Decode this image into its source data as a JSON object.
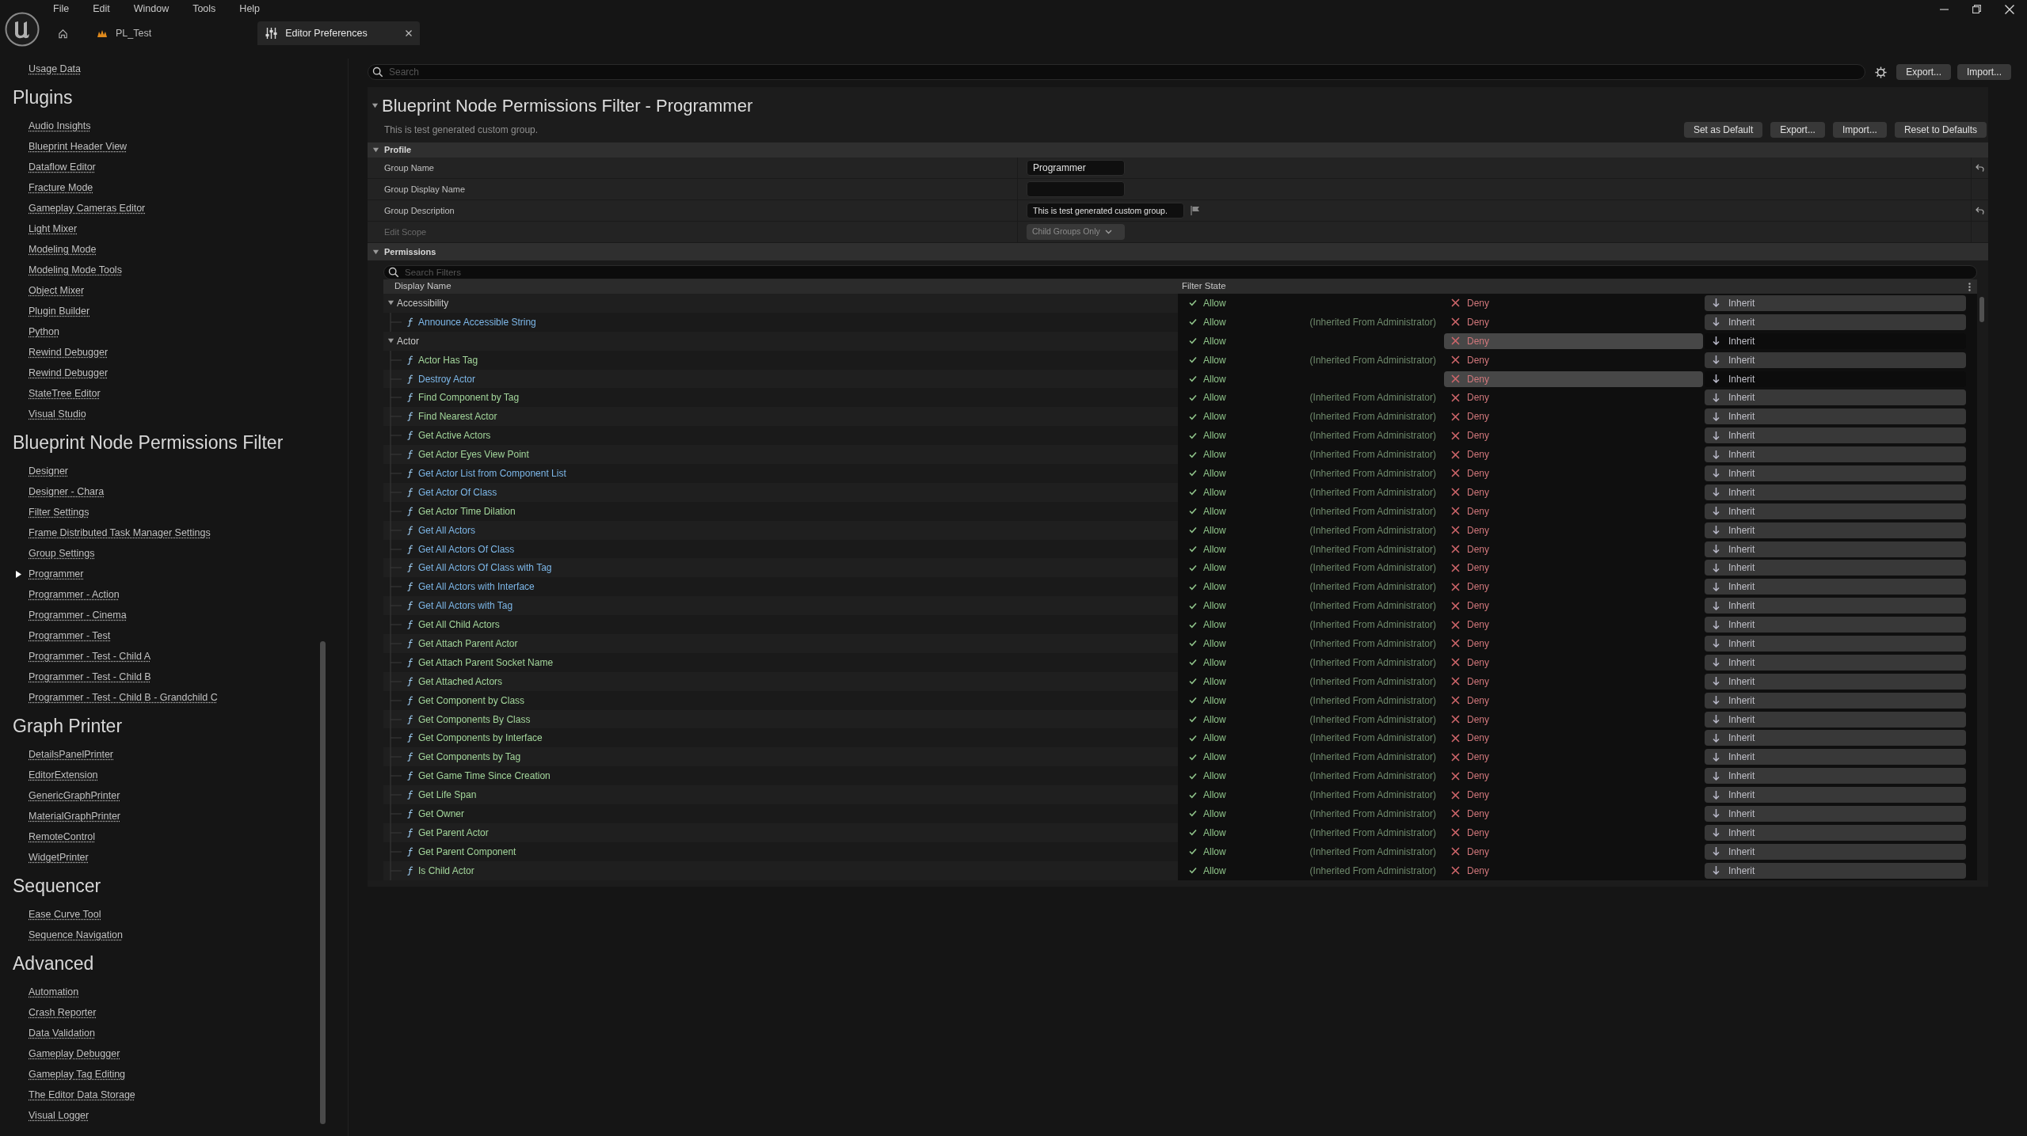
{
  "menu": [
    "File",
    "Edit",
    "Window",
    "Tools",
    "Help"
  ],
  "tabs": [
    {
      "label": "PL_Test",
      "selected": false
    },
    {
      "label": "Editor Preferences",
      "selected": true
    }
  ],
  "sidebar": {
    "top_items": [
      {
        "label": "Usage Data",
        "selected": false
      }
    ],
    "sections": [
      {
        "title": "Plugins",
        "items": [
          {
            "label": "Audio Insights",
            "selected": false
          },
          {
            "label": "Blueprint Header View",
            "selected": false
          },
          {
            "label": "Dataflow Editor",
            "selected": false
          },
          {
            "label": "Fracture Mode",
            "selected": false
          },
          {
            "label": "Gameplay Cameras Editor",
            "selected": false
          },
          {
            "label": "Light Mixer",
            "selected": false
          },
          {
            "label": "Modeling Mode",
            "selected": false
          },
          {
            "label": "Modeling Mode Tools",
            "selected": false
          },
          {
            "label": "Object Mixer",
            "selected": false
          },
          {
            "label": "Plugin Builder",
            "selected": false
          },
          {
            "label": "Python",
            "selected": false
          },
          {
            "label": "Rewind Debugger",
            "selected": false
          },
          {
            "label": "Rewind Debugger",
            "selected": false
          },
          {
            "label": "StateTree Editor",
            "selected": false
          },
          {
            "label": "Visual Studio",
            "selected": false
          }
        ]
      },
      {
        "title": "Blueprint Node Permissions Filter",
        "items": [
          {
            "label": "Designer",
            "selected": false
          },
          {
            "label": "Designer - Chara",
            "selected": false
          },
          {
            "label": "Filter Settings",
            "selected": false
          },
          {
            "label": "Frame Distributed Task Manager Settings",
            "selected": false
          },
          {
            "label": "Group Settings",
            "selected": false
          },
          {
            "label": "Programmer",
            "selected": true
          },
          {
            "label": "Programmer - Action",
            "selected": false
          },
          {
            "label": "Programmer - Cinema",
            "selected": false
          },
          {
            "label": "Programmer - Test",
            "selected": false
          },
          {
            "label": "Programmer - Test - Child A",
            "selected": false
          },
          {
            "label": "Programmer - Test - Child B",
            "selected": false
          },
          {
            "label": "Programmer - Test - Child B - Grandchild C",
            "selected": false
          }
        ]
      },
      {
        "title": "Graph Printer",
        "items": [
          {
            "label": "DetailsPanelPrinter",
            "selected": false
          },
          {
            "label": "EditorExtension",
            "selected": false
          },
          {
            "label": "GenericGraphPrinter",
            "selected": false
          },
          {
            "label": "MaterialGraphPrinter",
            "selected": false
          },
          {
            "label": "RemoteControl",
            "selected": false
          },
          {
            "label": "WidgetPrinter",
            "selected": false
          }
        ]
      },
      {
        "title": "Sequencer",
        "items": [
          {
            "label": "Ease Curve Tool",
            "selected": false
          },
          {
            "label": "Sequence Navigation",
            "selected": false
          }
        ]
      },
      {
        "title": "Advanced",
        "items": [
          {
            "label": "Automation",
            "selected": false
          },
          {
            "label": "Crash Reporter",
            "selected": false
          },
          {
            "label": "Data Validation",
            "selected": false
          },
          {
            "label": "Gameplay Debugger",
            "selected": false
          },
          {
            "label": "Gameplay Tag Editing",
            "selected": false
          },
          {
            "label": "The Editor Data Storage",
            "selected": false
          },
          {
            "label": "Visual Logger",
            "selected": false
          }
        ]
      }
    ]
  },
  "search": {
    "placeholder": "Search"
  },
  "toolbar_buttons": [
    "Export...",
    "Import..."
  ],
  "header": {
    "title": "Blueprint Node Permissions Filter - Programmer",
    "expanded": true,
    "description": "This is test generated custom group.",
    "buttons": [
      "Set as Default",
      "Export...",
      "Import...",
      "Reset to Defaults"
    ]
  },
  "profile": {
    "title": "Profile",
    "expanded": true,
    "fields": [
      {
        "label": "Group Name",
        "kind": "text",
        "value": "Programmer",
        "disabled": false,
        "reset": true
      },
      {
        "label": "Group Display Name",
        "kind": "text",
        "disabled": false,
        "reset": false
      },
      {
        "label": "Group Description",
        "kind": "flagged_text",
        "value": "This is test generated custom group.",
        "disabled": false,
        "reset": true
      },
      {
        "label": "Edit Scope",
        "kind": "dropdown",
        "value": "Child Groups Only",
        "disabled": true,
        "reset": false
      }
    ]
  },
  "permissions": {
    "title": "Permissions",
    "expanded": true,
    "search_placeholder": "Search Filters",
    "columns": [
      "Display Name",
      "Filter State"
    ],
    "groups": [
      {
        "name": "Accessibility",
        "expanded": true,
        "options": [
          {
            "label": "Allow",
            "selected": false
          },
          {
            "label": "Deny",
            "selected": false
          },
          {
            "label": "Inherit",
            "selected": true
          }
        ],
        "children": [
          {
            "name": "Announce Accessible String",
            "color": "#7db7e8",
            "note": "(Inherited From Administrator)",
            "options": [
              {
                "label": "Allow",
                "selected": false
              },
              {
                "label": "Deny",
                "selected": false
              },
              {
                "label": "Inherit",
                "selected": true
              }
            ]
          }
        ]
      },
      {
        "name": "Actor",
        "expanded": true,
        "options": [
          {
            "label": "Allow",
            "selected": false
          },
          {
            "label": "Deny",
            "selected": true
          },
          {
            "label": "Inherit",
            "selected": false
          }
        ],
        "children": [
          {
            "name": "Actor Has Tag",
            "color": "#a3d69b",
            "note": "(Inherited From Administrator)",
            "options": [
              {
                "label": "Allow",
                "selected": false
              },
              {
                "label": "Deny",
                "selected": false
              },
              {
                "label": "Inherit",
                "selected": true
              }
            ]
          },
          {
            "name": "Destroy Actor",
            "color": "#7db7e8",
            "options": [
              {
                "label": "Allow",
                "selected": false
              },
              {
                "label": "Deny",
                "selected": true
              },
              {
                "label": "Inherit",
                "selected": false
              }
            ]
          },
          {
            "name": "Find Component by Tag",
            "color": "#a3d69b",
            "note": "(Inherited From Administrator)",
            "options": [
              {
                "label": "Allow",
                "selected": false
              },
              {
                "label": "Deny",
                "selected": false
              },
              {
                "label": "Inherit",
                "selected": true
              }
            ]
          },
          {
            "name": "Find Nearest Actor",
            "color": "#a3d69b",
            "note": "(Inherited From Administrator)",
            "options": [
              {
                "label": "Allow",
                "selected": false
              },
              {
                "label": "Deny",
                "selected": false
              },
              {
                "label": "Inherit",
                "selected": true
              }
            ]
          },
          {
            "name": "Get Active Actors",
            "color": "#a3d69b",
            "note": "(Inherited From Administrator)",
            "options": [
              {
                "label": "Allow",
                "selected": false
              },
              {
                "label": "Deny",
                "selected": false
              },
              {
                "label": "Inherit",
                "selected": true
              }
            ]
          },
          {
            "name": "Get Actor Eyes View Point",
            "color": "#a3d69b",
            "note": "(Inherited From Administrator)",
            "options": [
              {
                "label": "Allow",
                "selected": false
              },
              {
                "label": "Deny",
                "selected": false
              },
              {
                "label": "Inherit",
                "selected": true
              }
            ]
          },
          {
            "name": "Get Actor List from Component List",
            "color": "#7db7e8",
            "note": "(Inherited From Administrator)",
            "options": [
              {
                "label": "Allow",
                "selected": false
              },
              {
                "label": "Deny",
                "selected": false
              },
              {
                "label": "Inherit",
                "selected": true
              }
            ]
          },
          {
            "name": "Get Actor Of Class",
            "color": "#7db7e8",
            "note": "(Inherited From Administrator)",
            "options": [
              {
                "label": "Allow",
                "selected": false
              },
              {
                "label": "Deny",
                "selected": false
              },
              {
                "label": "Inherit",
                "selected": true
              }
            ]
          },
          {
            "name": "Get Actor Time Dilation",
            "color": "#a3d69b",
            "note": "(Inherited From Administrator)",
            "options": [
              {
                "label": "Allow",
                "selected": false
              },
              {
                "label": "Deny",
                "selected": false
              },
              {
                "label": "Inherit",
                "selected": true
              }
            ]
          },
          {
            "name": "Get All Actors",
            "color": "#7db7e8",
            "note": "(Inherited From Administrator)",
            "options": [
              {
                "label": "Allow",
                "selected": false
              },
              {
                "label": "Deny",
                "selected": false
              },
              {
                "label": "Inherit",
                "selected": true
              }
            ]
          },
          {
            "name": "Get All Actors Of Class",
            "color": "#7db7e8",
            "note": "(Inherited From Administrator)",
            "options": [
              {
                "label": "Allow",
                "selected": false
              },
              {
                "label": "Deny",
                "selected": false
              },
              {
                "label": "Inherit",
                "selected": true
              }
            ]
          },
          {
            "name": "Get All Actors Of Class with Tag",
            "color": "#7db7e8",
            "note": "(Inherited From Administrator)",
            "options": [
              {
                "label": "Allow",
                "selected": false
              },
              {
                "label": "Deny",
                "selected": false
              },
              {
                "label": "Inherit",
                "selected": true
              }
            ]
          },
          {
            "name": "Get All Actors with Interface",
            "color": "#7db7e8",
            "note": "(Inherited From Administrator)",
            "options": [
              {
                "label": "Allow",
                "selected": false
              },
              {
                "label": "Deny",
                "selected": false
              },
              {
                "label": "Inherit",
                "selected": true
              }
            ]
          },
          {
            "name": "Get All Actors with Tag",
            "color": "#7db7e8",
            "note": "(Inherited From Administrator)",
            "options": [
              {
                "label": "Allow",
                "selected": false
              },
              {
                "label": "Deny",
                "selected": false
              },
              {
                "label": "Inherit",
                "selected": true
              }
            ]
          },
          {
            "name": "Get All Child Actors",
            "color": "#a3d69b",
            "note": "(Inherited From Administrator)",
            "options": [
              {
                "label": "Allow",
                "selected": false
              },
              {
                "label": "Deny",
                "selected": false
              },
              {
                "label": "Inherit",
                "selected": true
              }
            ]
          },
          {
            "name": "Get Attach Parent Actor",
            "color": "#a3d69b",
            "note": "(Inherited From Administrator)",
            "options": [
              {
                "label": "Allow",
                "selected": false
              },
              {
                "label": "Deny",
                "selected": false
              },
              {
                "label": "Inherit",
                "selected": true
              }
            ]
          },
          {
            "name": "Get Attach Parent Socket Name",
            "color": "#a3d69b",
            "note": "(Inherited From Administrator)",
            "options": [
              {
                "label": "Allow",
                "selected": false
              },
              {
                "label": "Deny",
                "selected": false
              },
              {
                "label": "Inherit",
                "selected": true
              }
            ]
          },
          {
            "name": "Get Attached Actors",
            "color": "#a3d69b",
            "note": "(Inherited From Administrator)",
            "options": [
              {
                "label": "Allow",
                "selected": false
              },
              {
                "label": "Deny",
                "selected": false
              },
              {
                "label": "Inherit",
                "selected": true
              }
            ]
          },
          {
            "name": "Get Component by Class",
            "color": "#a3d69b",
            "note": "(Inherited From Administrator)",
            "options": [
              {
                "label": "Allow",
                "selected": false
              },
              {
                "label": "Deny",
                "selected": false
              },
              {
                "label": "Inherit",
                "selected": true
              }
            ]
          },
          {
            "name": "Get Components By Class",
            "color": "#a3d69b",
            "note": "(Inherited From Administrator)",
            "options": [
              {
                "label": "Allow",
                "selected": false
              },
              {
                "label": "Deny",
                "selected": false
              },
              {
                "label": "Inherit",
                "selected": true
              }
            ]
          },
          {
            "name": "Get Components by Interface",
            "color": "#a3d69b",
            "note": "(Inherited From Administrator)",
            "options": [
              {
                "label": "Allow",
                "selected": false
              },
              {
                "label": "Deny",
                "selected": false
              },
              {
                "label": "Inherit",
                "selected": true
              }
            ]
          },
          {
            "name": "Get Components by Tag",
            "color": "#a3d69b",
            "note": "(Inherited From Administrator)",
            "options": [
              {
                "label": "Allow",
                "selected": false
              },
              {
                "label": "Deny",
                "selected": false
              },
              {
                "label": "Inherit",
                "selected": true
              }
            ]
          },
          {
            "name": "Get Game Time Since Creation",
            "color": "#a3d69b",
            "note": "(Inherited From Administrator)",
            "options": [
              {
                "label": "Allow",
                "selected": false
              },
              {
                "label": "Deny",
                "selected": false
              },
              {
                "label": "Inherit",
                "selected": true
              }
            ]
          },
          {
            "name": "Get Life Span",
            "color": "#a3d69b",
            "note": "(Inherited From Administrator)",
            "options": [
              {
                "label": "Allow",
                "selected": false
              },
              {
                "label": "Deny",
                "selected": false
              },
              {
                "label": "Inherit",
                "selected": true
              }
            ]
          },
          {
            "name": "Get Owner",
            "color": "#a3d69b",
            "note": "(Inherited From Administrator)",
            "options": [
              {
                "label": "Allow",
                "selected": false
              },
              {
                "label": "Deny",
                "selected": false
              },
              {
                "label": "Inherit",
                "selected": true
              }
            ]
          },
          {
            "name": "Get Parent Actor",
            "color": "#a3d69b",
            "note": "(Inherited From Administrator)",
            "options": [
              {
                "label": "Allow",
                "selected": false
              },
              {
                "label": "Deny",
                "selected": false
              },
              {
                "label": "Inherit",
                "selected": true
              }
            ]
          },
          {
            "name": "Get Parent Component",
            "color": "#a3d69b",
            "note": "(Inherited From Administrator)",
            "options": [
              {
                "label": "Allow",
                "selected": false
              },
              {
                "label": "Deny",
                "selected": false
              },
              {
                "label": "Inherit",
                "selected": true
              }
            ]
          },
          {
            "name": "Is Child Actor",
            "color": "#a3d69b",
            "note": "(Inherited From Administrator)",
            "options": [
              {
                "label": "Allow",
                "selected": false
              },
              {
                "label": "Deny",
                "selected": false
              },
              {
                "label": "Inherit",
                "selected": true
              }
            ]
          }
        ]
      }
    ]
  }
}
